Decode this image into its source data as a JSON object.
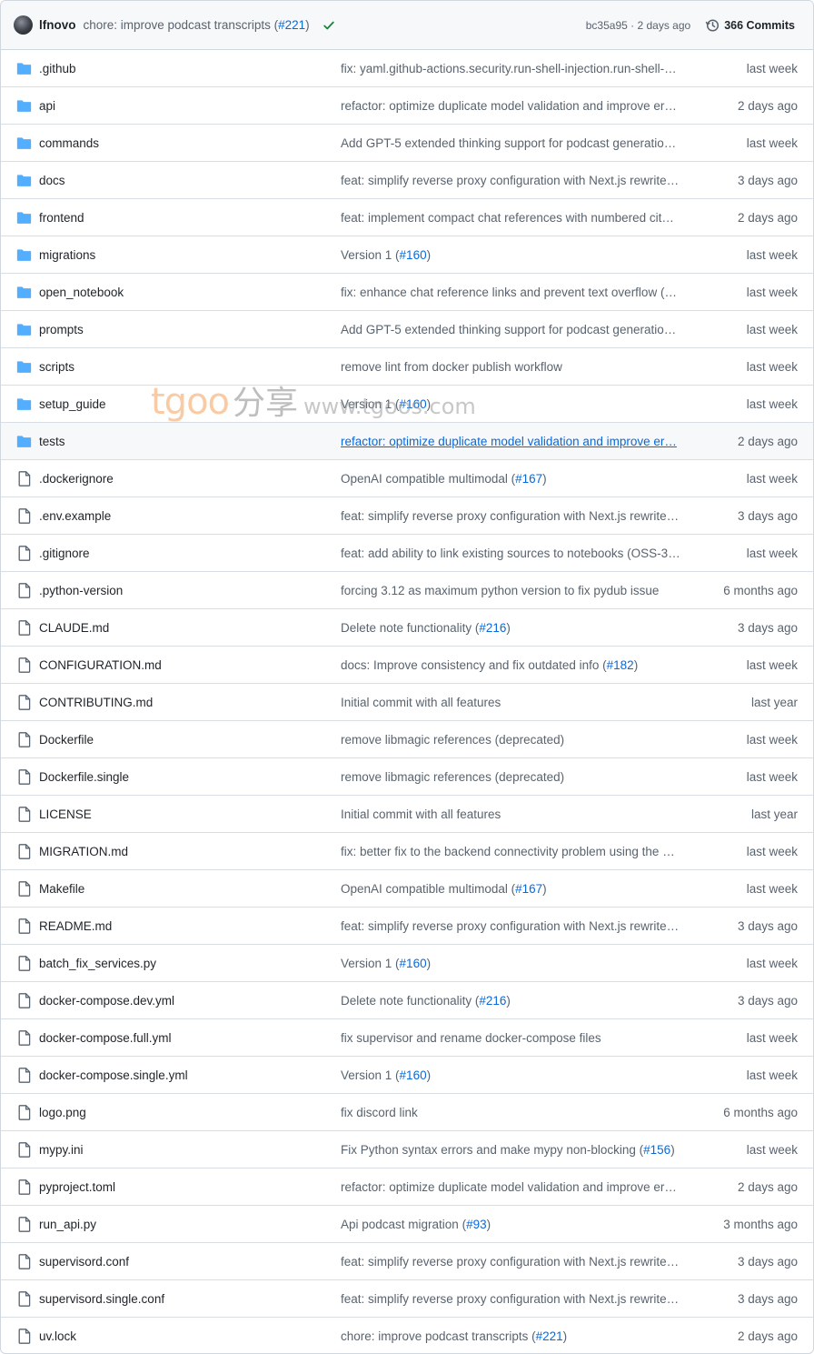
{
  "commit": {
    "author": "lfnovo",
    "message_prefix": "chore: improve podcast transcripts (",
    "pr": "#221",
    "message_suffix": ")",
    "sha": "bc35a95",
    "sep": " · ",
    "age": "2 days ago",
    "commits_label": "366 Commits"
  },
  "colors": {
    "link": "#0969da",
    "folder": "#54aeff",
    "check": "#1a7f37"
  },
  "entries": [
    {
      "type": "folder",
      "name": ".github",
      "msg": "fix: yaml.github-actions.security.run-shell-injection.run-shell-…",
      "pr": "",
      "date": "last week"
    },
    {
      "type": "folder",
      "name": "api",
      "msg": "refactor: optimize duplicate model validation and improve er…",
      "pr": "",
      "date": "2 days ago"
    },
    {
      "type": "folder",
      "name": "commands",
      "msg": "Add GPT-5 extended thinking support for podcast generatio…",
      "pr": "",
      "date": "last week"
    },
    {
      "type": "folder",
      "name": "docs",
      "msg": "feat: simplify reverse proxy configuration with Next.js rewrite…",
      "pr": "",
      "date": "3 days ago"
    },
    {
      "type": "folder",
      "name": "frontend",
      "msg": "feat: implement compact chat references with numbered cit…",
      "pr": "",
      "date": "2 days ago"
    },
    {
      "type": "folder",
      "name": "migrations",
      "msg": "Version 1 (",
      "pr": "#160",
      "date": "last week"
    },
    {
      "type": "folder",
      "name": "open_notebook",
      "msg": "fix: enhance chat reference links and prevent text overflow (…",
      "pr": "",
      "date": "last week"
    },
    {
      "type": "folder",
      "name": "prompts",
      "msg": "Add GPT-5 extended thinking support for podcast generatio…",
      "pr": "",
      "date": "last week"
    },
    {
      "type": "folder",
      "name": "scripts",
      "msg": "remove lint from docker publish workflow",
      "pr": "",
      "date": "last week"
    },
    {
      "type": "folder",
      "name": "setup_guide",
      "msg": "Version 1 (",
      "pr": "#160",
      "date": "last week"
    },
    {
      "type": "folder",
      "name": "tests",
      "msg": "refactor: optimize duplicate model validation and improve er…",
      "pr": "",
      "date": "2 days ago",
      "hover": true
    },
    {
      "type": "file",
      "name": ".dockerignore",
      "msg": "OpenAI compatible multimodal (",
      "pr": "#167",
      "date": "last week"
    },
    {
      "type": "file",
      "name": ".env.example",
      "msg": "feat: simplify reverse proxy configuration with Next.js rewrite…",
      "pr": "",
      "date": "3 days ago"
    },
    {
      "type": "file",
      "name": ".gitignore",
      "msg": "feat: add ability to link existing sources to notebooks (OSS-3…",
      "pr": "",
      "date": "last week"
    },
    {
      "type": "file",
      "name": ".python-version",
      "msg": "forcing 3.12 as maximum python version to fix pydub issue",
      "pr": "",
      "date": "6 months ago"
    },
    {
      "type": "file",
      "name": "CLAUDE.md",
      "msg": "Delete note functionality (",
      "pr": "#216",
      "date": "3 days ago"
    },
    {
      "type": "file",
      "name": "CONFIGURATION.md",
      "msg": "docs: Improve consistency and fix outdated info (",
      "pr": "#182",
      "date": "last week"
    },
    {
      "type": "file",
      "name": "CONTRIBUTING.md",
      "msg": "Initial commit with all features",
      "pr": "",
      "date": "last year"
    },
    {
      "type": "file",
      "name": "Dockerfile",
      "msg": "remove libmagic references (deprecated)",
      "pr": "",
      "date": "last week"
    },
    {
      "type": "file",
      "name": "Dockerfile.single",
      "msg": "remove libmagic references (deprecated)",
      "pr": "",
      "date": "last week"
    },
    {
      "type": "file",
      "name": "LICENSE",
      "msg": "Initial commit with all features",
      "pr": "",
      "date": "last year"
    },
    {
      "type": "file",
      "name": "MIGRATION.md",
      "msg": "fix: better fix to the backend connectivity problem using the …",
      "pr": "",
      "date": "last week"
    },
    {
      "type": "file",
      "name": "Makefile",
      "msg": "OpenAI compatible multimodal (",
      "pr": "#167",
      "date": "last week"
    },
    {
      "type": "file",
      "name": "README.md",
      "msg": "feat: simplify reverse proxy configuration with Next.js rewrite…",
      "pr": "",
      "date": "3 days ago"
    },
    {
      "type": "file",
      "name": "batch_fix_services.py",
      "msg": "Version 1 (",
      "pr": "#160",
      "date": "last week"
    },
    {
      "type": "file",
      "name": "docker-compose.dev.yml",
      "msg": "Delete note functionality (",
      "pr": "#216",
      "date": "3 days ago"
    },
    {
      "type": "file",
      "name": "docker-compose.full.yml",
      "msg": "fix supervisor and rename docker-compose files",
      "pr": "",
      "date": "last week"
    },
    {
      "type": "file",
      "name": "docker-compose.single.yml",
      "msg": "Version 1 (",
      "pr": "#160",
      "date": "last week"
    },
    {
      "type": "file",
      "name": "logo.png",
      "msg": "fix discord link",
      "pr": "",
      "date": "6 months ago"
    },
    {
      "type": "file",
      "name": "mypy.ini",
      "msg": "Fix Python syntax errors and make mypy non-blocking (",
      "pr": "#156",
      "date": "last week"
    },
    {
      "type": "file",
      "name": "pyproject.toml",
      "msg": "refactor: optimize duplicate model validation and improve er…",
      "pr": "",
      "date": "2 days ago"
    },
    {
      "type": "file",
      "name": "run_api.py",
      "msg": "Api podcast migration (",
      "pr": "#93",
      "date": "3 months ago"
    },
    {
      "type": "file",
      "name": "supervisord.conf",
      "msg": "feat: simplify reverse proxy configuration with Next.js rewrite…",
      "pr": "",
      "date": "3 days ago"
    },
    {
      "type": "file",
      "name": "supervisord.single.conf",
      "msg": "feat: simplify reverse proxy configuration with Next.js rewrite…",
      "pr": "",
      "date": "3 days ago"
    },
    {
      "type": "file",
      "name": "uv.lock",
      "msg": "chore: improve podcast transcripts (",
      "pr": "#221",
      "date": "2 days ago"
    }
  ],
  "watermark": {
    "brand": "tgoo",
    "cn": "分享",
    "url": "www.tgoos.com"
  }
}
